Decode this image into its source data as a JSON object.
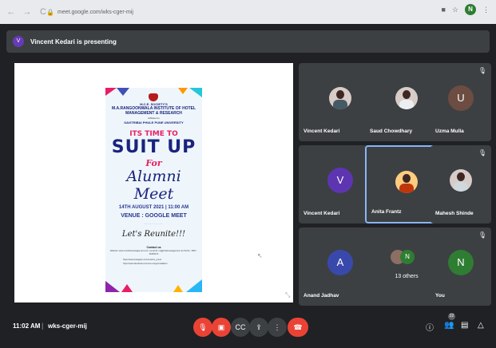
{
  "browser": {
    "url": "meet.google.com/wks-cger-mij",
    "profile_initial": "N"
  },
  "presenter_bar": {
    "initial": "V",
    "text": "Vincent Kedari is presenting"
  },
  "poster": {
    "society": "M.C.E. SOCIETY'S",
    "institute": "M.A.RANGOONWALA INSTITUTE OF HOTEL MANAGEMENT & RESEARCH",
    "affiliation": "Affiliated to",
    "university": "SAVITRIBAI PHULE PUNE UNIVERSITY",
    "line1": "ITS TIME TO",
    "line2": "SUIT UP",
    "line3": "For",
    "line4": "Alumni Meet",
    "date": "14TH AUGUST 2021 | 11:00 AM",
    "venue": "VENUE : GOOGLE MEET",
    "dots": "..........",
    "tagline": "Let's Reunite!!!",
    "contact": "Contact us",
    "website": "Website: www.mcehotelmanagement.com | email id: mij@hotelmanagement.net Tel No.: 9657 - 26463373",
    "social1": "https://www.instagram.com/mcehm_pune/",
    "social2": "https://www.facebook.com/mce.rangoonwalahm/"
  },
  "participants": [
    {
      "name": "Vincent Kedari",
      "type": "photo"
    },
    {
      "name": "Saud Chowdhary",
      "type": "photo"
    },
    {
      "name": "Uzma Mulla",
      "type": "initial",
      "initial": "U",
      "color": "#6d4c41"
    },
    {
      "name": "Vincent Kedari",
      "type": "initial",
      "initial": "V",
      "color": "#5e35b1"
    },
    {
      "name": "Anita Frantz",
      "type": "photo"
    },
    {
      "name": "Mahesh Shinde",
      "type": "photo"
    },
    {
      "name": "Anand Jadhav",
      "type": "initial",
      "initial": "A",
      "color": "#3949ab"
    },
    {
      "name": "13 others",
      "type": "others",
      "initial": "N",
      "color": "#2e7d32"
    },
    {
      "name": "You",
      "type": "initial",
      "initial": "N",
      "color": "#2e7d32"
    }
  ],
  "bottom_bar": {
    "time": "11:02 AM",
    "separator": "|",
    "meeting_code": "wks-cger-mij",
    "people_count": "22"
  },
  "colors": {
    "background": "#202124",
    "tile": "#3c4043",
    "danger": "#ea4335",
    "active_border": "#8ab4f8"
  }
}
